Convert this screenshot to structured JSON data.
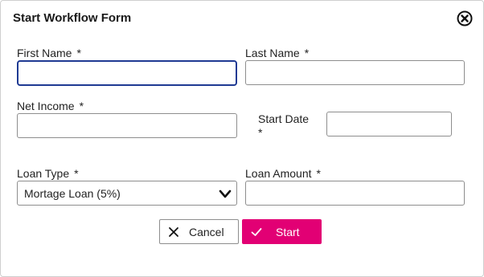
{
  "dialog": {
    "title": "Start Workflow Form",
    "close_icon": "close-circle-icon"
  },
  "fields": {
    "first_name": {
      "label": "First Name",
      "required": "*",
      "value": ""
    },
    "last_name": {
      "label": "Last Name",
      "required": "*",
      "value": ""
    },
    "net_income": {
      "label": "Net Income",
      "required": "*",
      "value": ""
    },
    "start_date": {
      "label": "Start Date",
      "required": "*",
      "value": ""
    },
    "loan_type": {
      "label": "Loan Type",
      "required": "*",
      "value": "Mortage Loan (5%)"
    },
    "loan_amount": {
      "label": "Loan Amount",
      "required": "*",
      "value": ""
    }
  },
  "buttons": {
    "cancel": {
      "label": "Cancel",
      "icon": "x-icon"
    },
    "start": {
      "label": "Start",
      "icon": "check-icon"
    }
  },
  "colors": {
    "accent": "#e20074",
    "focus_border": "#1f3a93",
    "input_border": "#8e8e8e"
  }
}
